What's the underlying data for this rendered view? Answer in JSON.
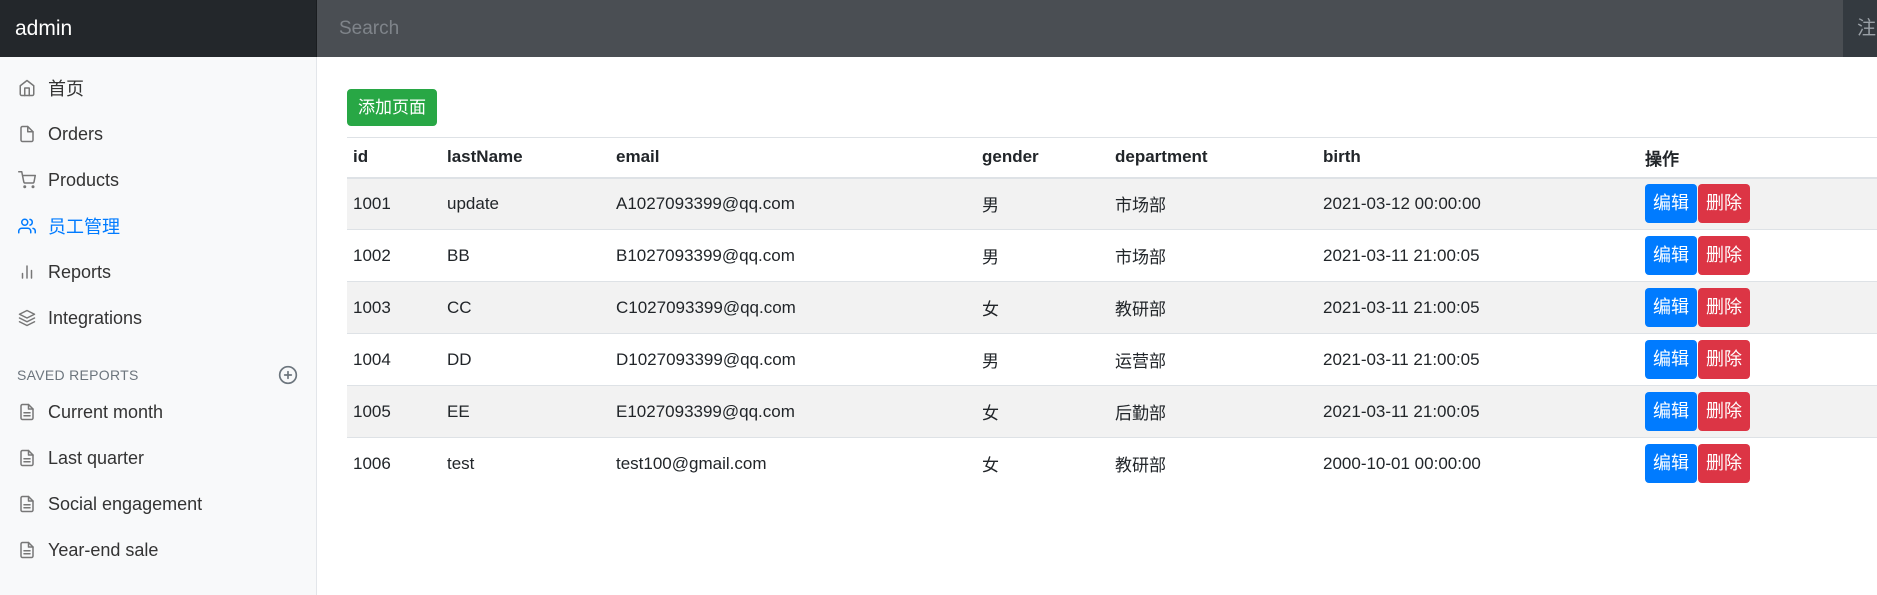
{
  "navbar": {
    "brand": "admin",
    "search_placeholder": "Search",
    "right_text": "注"
  },
  "sidebar": {
    "items": [
      {
        "label": "首页",
        "icon": "home-icon"
      },
      {
        "label": "Orders",
        "icon": "file-icon"
      },
      {
        "label": "Products",
        "icon": "cart-icon"
      },
      {
        "label": "员工管理",
        "icon": "users-icon",
        "active": true
      },
      {
        "label": "Reports",
        "icon": "bar-chart-icon"
      },
      {
        "label": "Integrations",
        "icon": "layers-icon"
      }
    ],
    "saved_reports_heading": "SAVED REPORTS",
    "saved_reports": [
      {
        "label": "Current month",
        "icon": "file-text-icon"
      },
      {
        "label": "Last quarter",
        "icon": "file-text-icon"
      },
      {
        "label": "Social engagement",
        "icon": "file-text-icon"
      },
      {
        "label": "Year-end sale",
        "icon": "file-text-icon"
      }
    ]
  },
  "main": {
    "add_button": "添加页面",
    "columns": [
      "id",
      "lastName",
      "email",
      "gender",
      "department",
      "birth",
      "操作"
    ],
    "edit_label": "编辑",
    "delete_label": "删除",
    "rows": [
      {
        "id": "1001",
        "lastName": "update",
        "email": "A1027093399@qq.com",
        "gender": "男",
        "department": "市场部",
        "birth": "2021-03-12 00:00:00"
      },
      {
        "id": "1002",
        "lastName": "BB",
        "email": "B1027093399@qq.com",
        "gender": "男",
        "department": "市场部",
        "birth": "2021-03-11 21:00:05"
      },
      {
        "id": "1003",
        "lastName": "CC",
        "email": "C1027093399@qq.com",
        "gender": "女",
        "department": "教研部",
        "birth": "2021-03-11 21:00:05"
      },
      {
        "id": "1004",
        "lastName": "DD",
        "email": "D1027093399@qq.com",
        "gender": "男",
        "department": "运营部",
        "birth": "2021-03-11 21:00:05"
      },
      {
        "id": "1005",
        "lastName": "EE",
        "email": "E1027093399@qq.com",
        "gender": "女",
        "department": "后勤部",
        "birth": "2021-03-11 21:00:05"
      },
      {
        "id": "1006",
        "lastName": "test",
        "email": "test100@gmail.com",
        "gender": "女",
        "department": "教研部",
        "birth": "2000-10-01 00:00:00"
      }
    ]
  },
  "colors": {
    "navbar": "#343a40",
    "brand_bg": "#23272b",
    "primary": "#007bff",
    "success": "#28a745",
    "danger": "#dc3545",
    "sidebar_bg": "#f8f9fa"
  }
}
